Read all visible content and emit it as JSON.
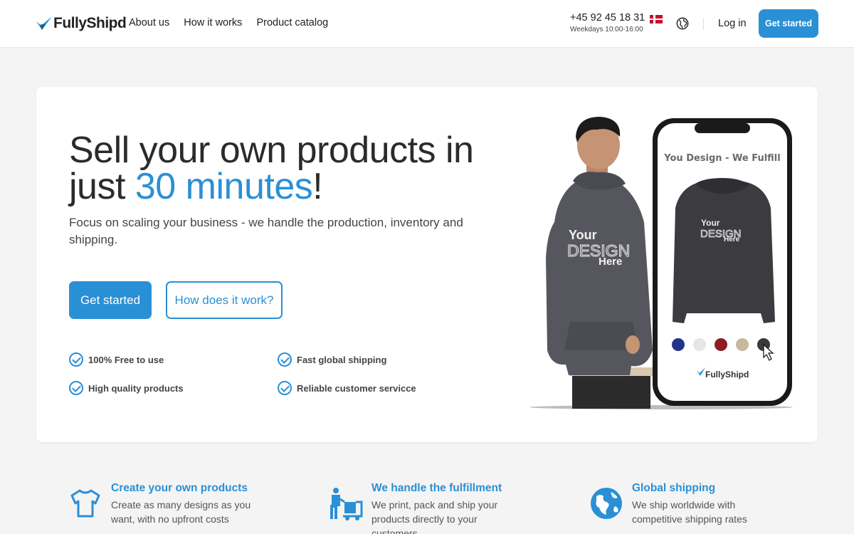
{
  "header": {
    "logo_text": "FullyShipd",
    "nav": [
      "About us",
      "How it works",
      "Product catalog"
    ],
    "phone": "+45 92 45 18 31",
    "hours": "Weekdays 10:00-16:00",
    "flag_icon": "denmark-flag-icon",
    "globe_icon": "globe-icon",
    "login_label": "Log in",
    "cta_label": "Get started"
  },
  "hero": {
    "title_prefix": "Sell your own products in just ",
    "title_accent": "30 minutes",
    "title_suffix": "!",
    "subtitle": "Focus on scaling your business - we handle the production, inventory and shipping.",
    "primary_button": "Get started",
    "secondary_button": "How does it work?",
    "features": [
      "100% Free to use",
      "Fast global shipping",
      "High quality products",
      "Reliable customer servicce"
    ],
    "illustration": {
      "phone_heading": "You Design - We Fulfill",
      "shirt_print": [
        "Your",
        "DESIGN",
        "Here"
      ],
      "phone_logo": "FullyShipd",
      "swatches": [
        "#24338a",
        "#e6e6e6",
        "#8c1e24",
        "#c7b8a0",
        "#3a3a3a"
      ]
    }
  },
  "features_row": [
    {
      "icon": "t-shirt-icon",
      "title": "Create your own products",
      "desc": "Create as many designs as you want, with no upfront costs"
    },
    {
      "icon": "delivery-worker-icon",
      "title": "We handle the fulfillment",
      "desc": "We print, pack and ship your products directly to your customers"
    },
    {
      "icon": "earth-icon",
      "title": "Global shipping",
      "desc": "We ship worldwide with competitive shipping rates"
    }
  ],
  "colors": {
    "accent": "#2a90d6",
    "text": "#2b2b2b",
    "background": "#f4f4f4"
  }
}
